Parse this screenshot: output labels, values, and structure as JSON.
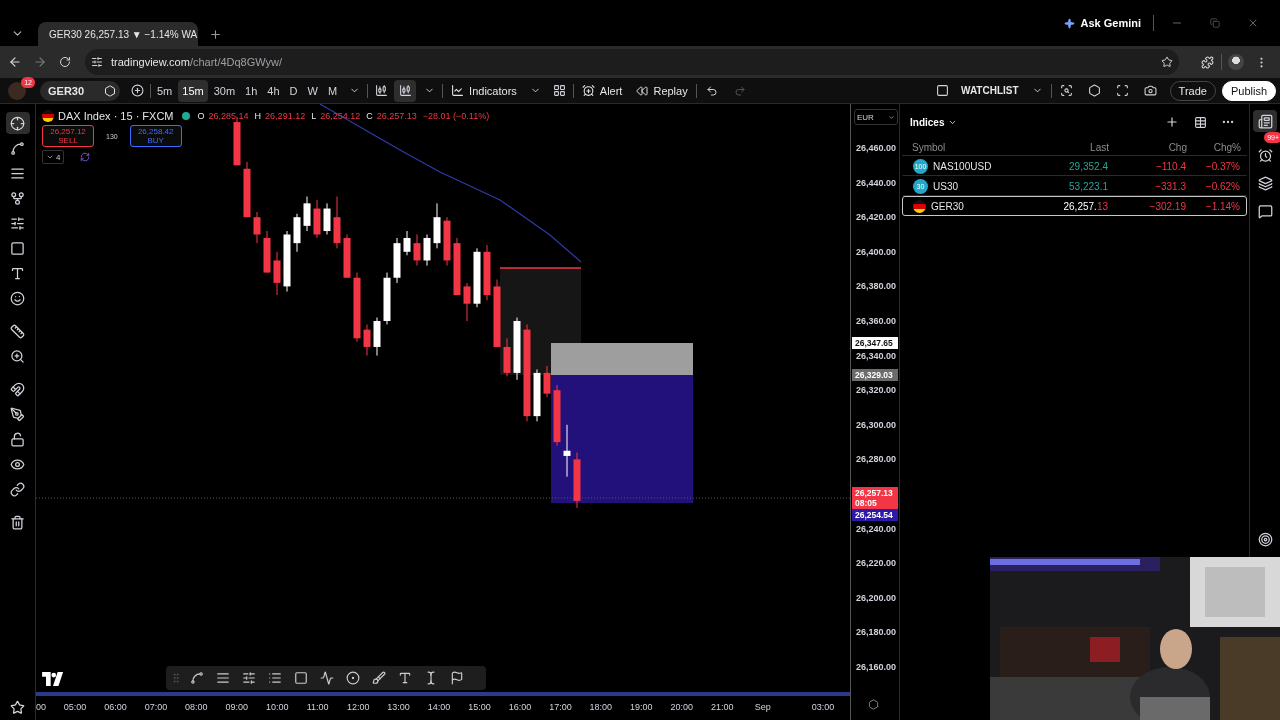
{
  "browser": {
    "tab_title": "GER30 26,257.13 ▼ −1.14% WA",
    "ask": "Ask Gemini",
    "url_host": "tradingview.com",
    "url_path": "/chart/4Dq8GWyw/"
  },
  "toolbar": {
    "avatar_badge": "12",
    "symbol": "GER30",
    "intervals": [
      {
        "label": "5m",
        "selected": false
      },
      {
        "label": "15m",
        "selected": true
      },
      {
        "label": "30m",
        "selected": false
      },
      {
        "label": "1h",
        "selected": false
      },
      {
        "label": "4h",
        "selected": false
      },
      {
        "label": "D",
        "selected": false
      },
      {
        "label": "W",
        "selected": false
      },
      {
        "label": "M",
        "selected": false
      }
    ],
    "indicators": "Indicators",
    "alert": "Alert",
    "replay": "Replay",
    "watchlist": "WATCHLIST",
    "trade": "Trade",
    "publish": "Publish"
  },
  "legend": {
    "title": "DAX Index · 15 · FXCM",
    "ohlc": [
      {
        "key": "O",
        "value": "26,285.14"
      },
      {
        "key": "H",
        "value": "26,291.12"
      },
      {
        "key": "L",
        "value": "26,254.12"
      },
      {
        "key": "C",
        "value": "26,257.13"
      }
    ],
    "change": "−28.01 (−0.11%)",
    "sell_price": "26,257.12",
    "sell": "SELL",
    "spread": "130",
    "buy_price": "26,258.42",
    "buy": "BUY",
    "count": "4"
  },
  "price_axis": {
    "currency": "EUR",
    "ticks": [
      "26,460.00",
      "26,440.00",
      "26,420.00",
      "26,400.00",
      "26,380.00",
      "26,360.00",
      "26,340.00",
      "26,320.00",
      "26,300.00",
      "26,280.00",
      "26,240.00",
      "26,220.00",
      "26,200.00",
      "26,180.00",
      "26,160.00"
    ],
    "markers": [
      {
        "kind": "crosshair",
        "text": "26,347.65"
      },
      {
        "kind": "drawing",
        "text": "26,329.03"
      },
      {
        "kind": "last",
        "text": "26,257.13",
        "sub": "08:05"
      },
      {
        "kind": "bid",
        "text": "26,254.54"
      }
    ]
  },
  "time_axis": {
    "ticks": [
      "00",
      "05:00",
      "06:00",
      "07:00",
      "08:00",
      "09:00",
      "10:00",
      "11:00",
      "12:00",
      "13:00",
      "14:00",
      "15:00",
      "16:00",
      "17:00",
      "18:00",
      "19:00",
      "20:00",
      "21:00",
      "Sep",
      "03:00"
    ]
  },
  "watchlist": {
    "title": "Indices",
    "columns": [
      "Symbol",
      "Last",
      "Chg",
      "Chg%"
    ],
    "rows": [
      {
        "kind": "badge",
        "badge": "100",
        "symbol": "NAS100USD",
        "last": "29,352.4",
        "color": "#26a69a",
        "chg": "−110.4",
        "chg_pct": "−0.37%",
        "selected": false
      },
      {
        "kind": "badge",
        "badge": "30",
        "symbol": "US30",
        "last": "53,223.1",
        "color": "#26a69a",
        "chg": "−331.3",
        "chg_pct": "−0.62%",
        "selected": false
      },
      {
        "kind": "flag",
        "symbol": "GER30",
        "last": "26,257.",
        "last_tail": "13",
        "chg": "−302.19",
        "chg_pct": "−1.14%",
        "selected": true
      }
    ]
  },
  "sidebar": {
    "alerts_badge": "99+"
  }
}
